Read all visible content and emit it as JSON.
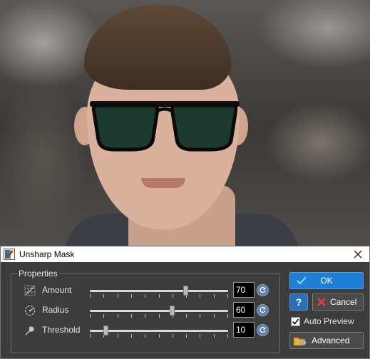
{
  "dialog": {
    "title": "Unsharp Mask",
    "group_label": "Properties",
    "rows": [
      {
        "label": "Amount",
        "value": "70",
        "slider_fraction": 0.7,
        "icon": "grid-sharpen-icon"
      },
      {
        "label": "Radius",
        "value": "60",
        "slider_fraction": 0.6,
        "icon": "radius-icon"
      },
      {
        "label": "Threshold",
        "value": "10",
        "slider_fraction": 0.1,
        "icon": "threshold-icon"
      }
    ],
    "ok_label": "OK",
    "help_label": "?",
    "cancel_label": "Cancel",
    "auto_preview_label": "Auto Preview",
    "auto_preview_checked": true,
    "advanced_label": "Advanced"
  },
  "colors": {
    "dialog_bg": "#3c3c3c",
    "ok_blue": "#1f7fd6",
    "cancel_red": "#e04040"
  }
}
